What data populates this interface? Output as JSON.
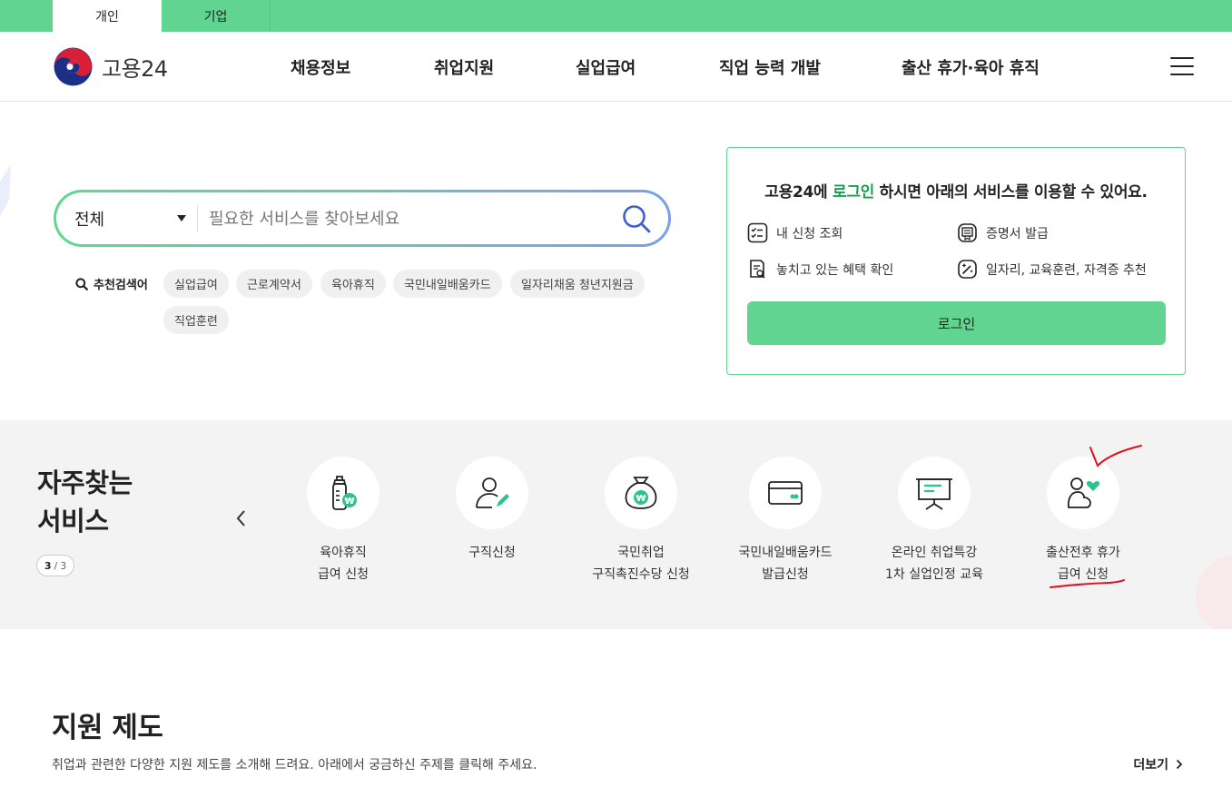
{
  "top_tabs": {
    "personal": "개인",
    "corporate": "기업"
  },
  "header": {
    "logo_text": "고용24",
    "nav": [
      "채용정보",
      "취업지원",
      "실업급여",
      "직업 능력 개발",
      "출산 휴가·육아 휴직"
    ]
  },
  "search": {
    "category": "전체",
    "placeholder": "필요한 서비스를 찾아보세요",
    "recommended_label": "추천검색어",
    "chips": [
      "실업급여",
      "근로계약서",
      "육아휴직",
      "국민내일배움카드",
      "일자리채움 청년지원금",
      "직업훈련"
    ]
  },
  "login": {
    "msg_prefix": "고용24에 ",
    "msg_highlight": "로그인",
    "msg_suffix": " 하시면 아래의 서비스를 이용할 수 있어요.",
    "features": [
      "내 신청 조회",
      "증명서 발급",
      "놓치고 있는 혜택 확인",
      "일자리, 교육훈련, 자격증 추천"
    ],
    "button": "로그인"
  },
  "frequent": {
    "title_line1": "자주찾는",
    "title_line2": "서비스",
    "pager_current": "3",
    "pager_sep": "/",
    "pager_total": "3",
    "items": [
      {
        "line1": "육아휴직",
        "line2": "급여 신청",
        "icon": "baby-bottle-icon"
      },
      {
        "line1": "구직신청",
        "line2": "",
        "icon": "person-pen-icon"
      },
      {
        "line1": "국민취업",
        "line2": "구직촉진수당 신청",
        "icon": "money-bag-icon"
      },
      {
        "line1": "국민내일배움카드",
        "line2": "발급신청",
        "icon": "card-icon"
      },
      {
        "line1": "온라인 취업특강",
        "line2": "1차 실업인정 교육",
        "icon": "presentation-board-icon"
      },
      {
        "line1": "출산전후 휴가",
        "line2": "급여 신청",
        "icon": "mother-heart-icon"
      }
    ]
  },
  "support": {
    "title": "지원 제도",
    "desc": "취업과 관련한 다양한 지원 제도를 소개해 드려요. 아래에서 궁금하신 주제를 클릭해 주세요.",
    "more": "더보기"
  },
  "colors": {
    "brand_green": "#61d491",
    "highlight_green": "#1a9e4b",
    "icon_teal": "#2ec28e",
    "annotation_red": "#e0101a"
  }
}
